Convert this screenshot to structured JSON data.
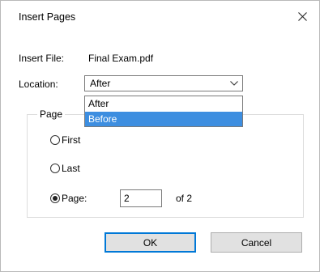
{
  "window": {
    "title": "Insert Pages"
  },
  "insert_file": {
    "label": "Insert File:",
    "value": "Final Exam.pdf"
  },
  "location": {
    "label": "Location:",
    "selected": "After",
    "options": [
      "After",
      "Before"
    ],
    "highlighted": "Before"
  },
  "page_group": {
    "legend": "Page",
    "first_label": "First",
    "last_label": "Last",
    "page_label": "Page:",
    "page_value": "2",
    "of_label": "of 2"
  },
  "buttons": {
    "ok": "OK",
    "cancel": "Cancel"
  },
  "colors": {
    "highlight": "#3d8ee0",
    "default_button_border": "#0078d7"
  }
}
